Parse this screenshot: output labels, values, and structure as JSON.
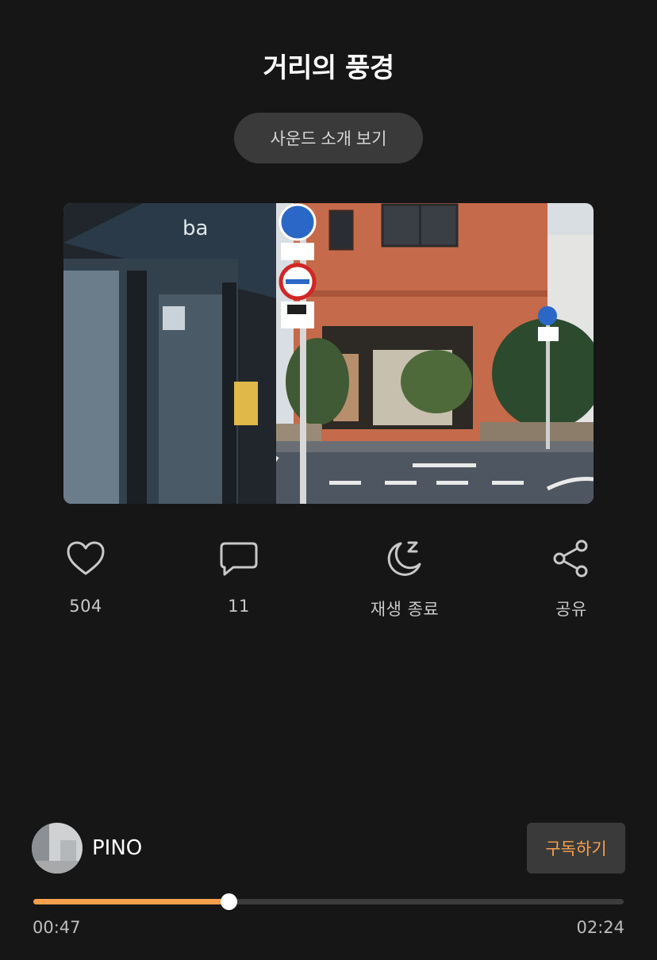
{
  "header": {
    "title": "거리의 풍경"
  },
  "intro_button": {
    "label": "사운드 소개 보기"
  },
  "actions": {
    "like": {
      "icon": "heart-icon",
      "count": "504"
    },
    "comment": {
      "icon": "comment-icon",
      "count": "11"
    },
    "sleep_timer": {
      "icon": "moon-zz-icon",
      "label": "재생 종료"
    },
    "share": {
      "icon": "share-icon",
      "label": "공유"
    }
  },
  "artist": {
    "name": "PINO"
  },
  "subscribe": {
    "label": "구독하기"
  },
  "player": {
    "elapsed": "00:47",
    "duration": "02:24",
    "progress": 0.33
  },
  "colors": {
    "background": "#161616",
    "accent": "#f6a04d",
    "button_bg": "#3a3a3a"
  }
}
